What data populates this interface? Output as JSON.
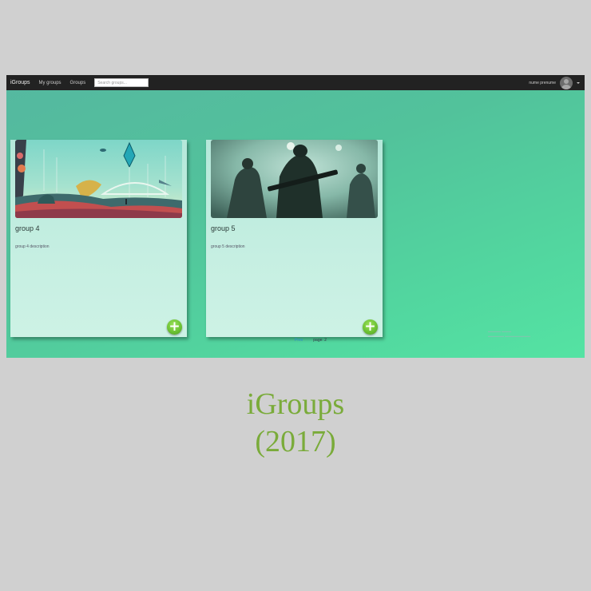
{
  "navbar": {
    "brand": "iGroups",
    "links": [
      "My groups",
      "Groups"
    ],
    "search_placeholder": "Search groups...",
    "user_name": "nume prenume"
  },
  "groups": [
    {
      "title": "group 4",
      "description": "group 4 description",
      "image": "space-landscape-image"
    },
    {
      "title": "group 5",
      "description": "group 5 description",
      "image": "soldiers-image"
    }
  ],
  "pagination": {
    "prev": "Prev",
    "page": "page: 2"
  },
  "caption": {
    "title": "iGroups",
    "year": "(2017)"
  },
  "colors": {
    "navbar": "#222222",
    "background_start": "#55b8a0",
    "background_end": "#54e3a3",
    "card": "#c6efe2",
    "add_button": "#6cc234",
    "caption": "#7aab3a",
    "page_bg": "#d0d0d0"
  }
}
